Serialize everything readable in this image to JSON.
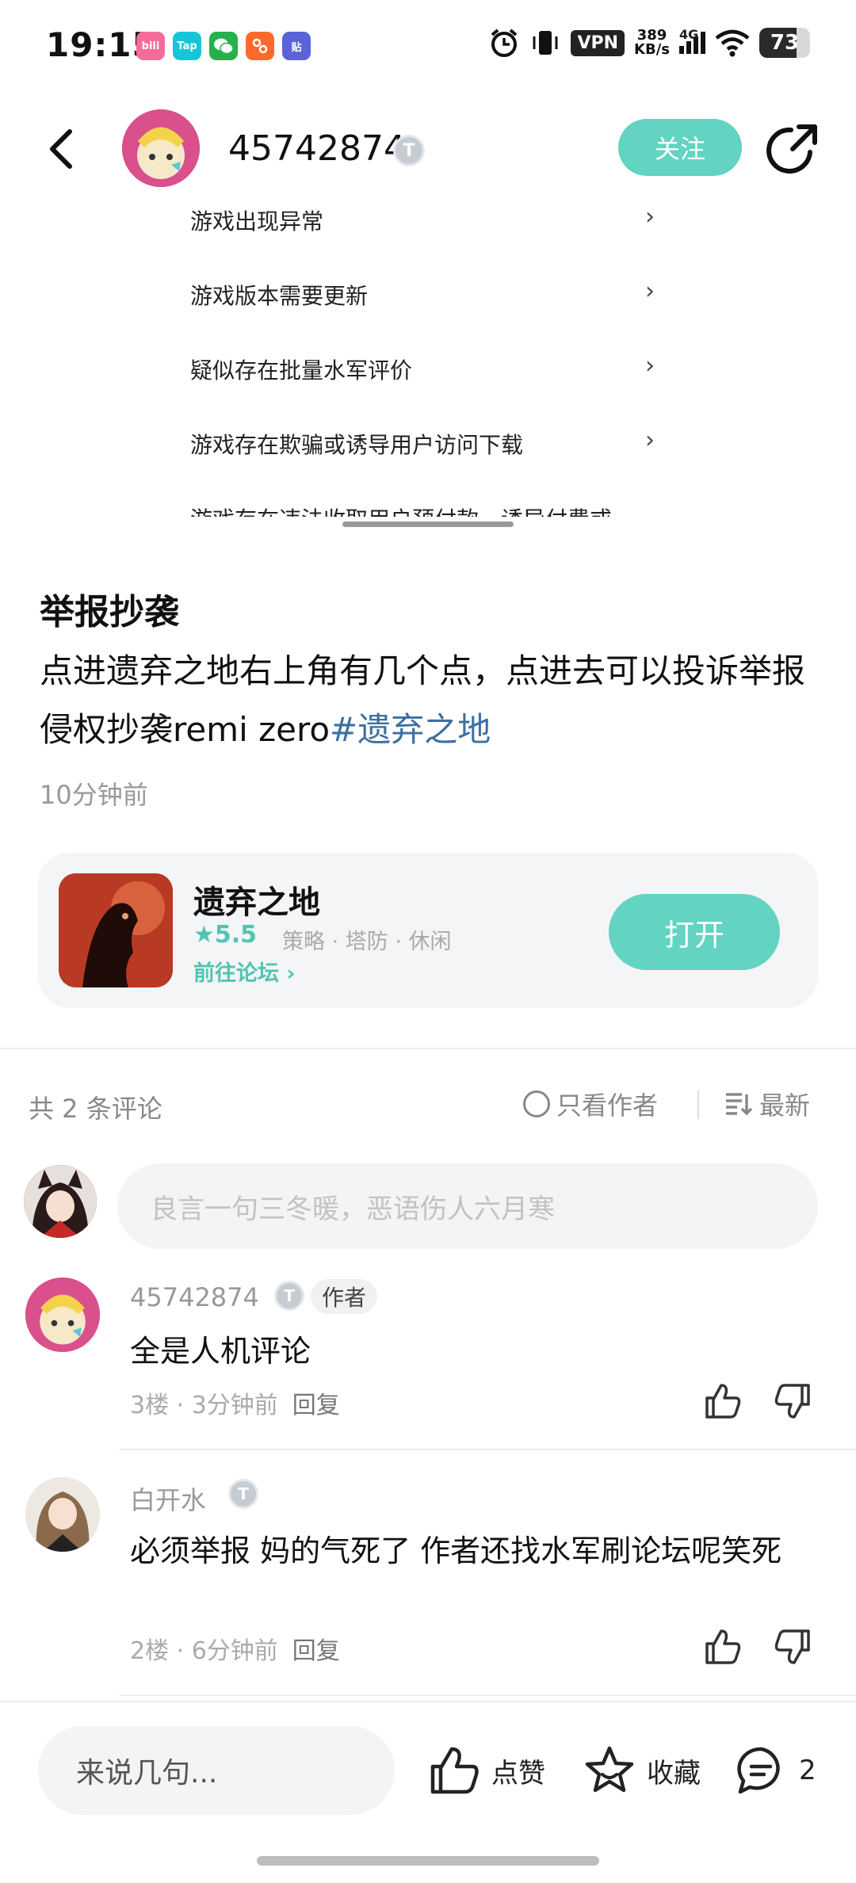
{
  "status_bar": {
    "time": "19:15",
    "app_icons": [
      {
        "name": "bilibili-icon",
        "label": "bili",
        "color": "#f46d9a"
      },
      {
        "name": "taptap-icon",
        "label": "Tap",
        "color": "#16c6d8"
      },
      {
        "name": "wechat-icon",
        "label": "",
        "color": "#26b14c"
      },
      {
        "name": "taobao-icon",
        "label": "",
        "color": "#ff6a2c"
      },
      {
        "name": "tieba-icon",
        "label": "贴",
        "color": "#5b63d8"
      }
    ],
    "vpn": "VPN",
    "speed_value": "389",
    "speed_unit": "KB/s",
    "network": "4G",
    "battery": "73",
    "battery_level": 0.73
  },
  "header": {
    "username": "45742874",
    "badge": "T",
    "follow_label": "关注"
  },
  "report_menu": {
    "items": [
      "游戏出现异常",
      "游戏版本需要更新",
      "疑似存在批量水军评价",
      "游戏存在欺骗或诱导用户访问下载",
      "游戏存在违法收取用户预付款、诱导付费或"
    ]
  },
  "post": {
    "title": "举报抄袭",
    "body": "点进遗弃之地右上角有几个点，点进去可以投诉举报侵权抄袭remi zero",
    "hashtag": "#遗弃之地",
    "time": "10分钟前"
  },
  "game": {
    "name": "遗弃之地",
    "rating": "5.5",
    "tags": "策略 · 塔防 · 休闲",
    "forum_link": "前往论坛",
    "open_label": "打开"
  },
  "comments_header": {
    "count": "共 2 条评论",
    "author_only": "只看作者",
    "sort": "最新"
  },
  "comment_input": {
    "placeholder": "良言一句三冬暖，恶语伤人六月寒"
  },
  "comments": [
    {
      "name": "45742874",
      "badge": "T",
      "author_tag": "作者",
      "text": "全是人机评论",
      "floor": "3楼",
      "time": "3分钟前",
      "reply": "回复"
    },
    {
      "name": "白开水",
      "badge": "T",
      "text": "必须举报 妈的气死了 作者还找水军刷论坛呢笑死",
      "floor": "2楼",
      "time": "6分钟前",
      "reply": "回复"
    }
  ],
  "bottom_bar": {
    "input_placeholder": "来说几句...",
    "like_label": "点赞",
    "favorite_label": "收藏",
    "comment_count": "2"
  },
  "colors": {
    "accent": "#63d3c2",
    "hashtag": "#3e6f9f"
  }
}
